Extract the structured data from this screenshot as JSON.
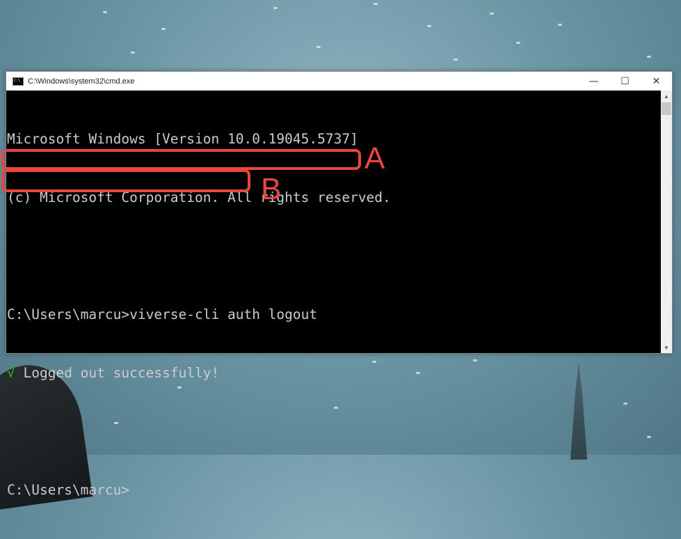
{
  "window": {
    "title": "C:\\Windows\\system32\\cmd.exe",
    "controls": {
      "minimize": "—",
      "maximize": "☐",
      "close": "✕"
    }
  },
  "console": {
    "lines": [
      "Microsoft Windows [Version 10.0.19045.5737]",
      "(c) Microsoft Corporation. All rights reserved.",
      "",
      "C:\\Users\\marcu>viverse-cli auth logout",
      "Logged out successfully!",
      "",
      "C:\\Users\\marcu>"
    ],
    "success_mark": "√",
    "success_color": "#16c60c"
  },
  "annotations": {
    "a_label": "A",
    "b_label": "B",
    "color": "#e8463e"
  },
  "scrollbar": {
    "up_arrow": "▲",
    "down_arrow": "▼"
  }
}
